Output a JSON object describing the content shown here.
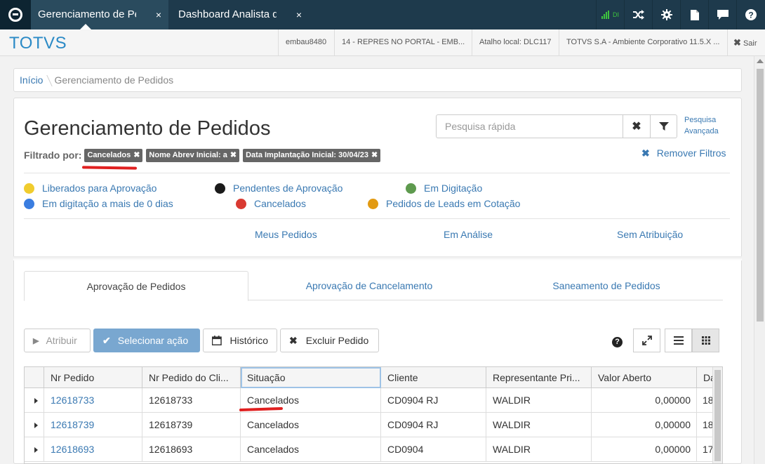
{
  "topbar": {
    "tabs": [
      {
        "label": "Gerenciamento de Pedidos",
        "close": "×"
      },
      {
        "label": "Dashboard Analista de",
        "close": "×"
      }
    ],
    "signal_label": "DI"
  },
  "header": {
    "brand": "TOTVS",
    "cells": [
      "embau8480",
      "14 - REPRES NO PORTAL - EMB...",
      "Atalho local: DLC117",
      "TOTVS S.A - Ambiente Corporativo 11.5.X ..."
    ],
    "logout_label": "Sair"
  },
  "breadcrumb": {
    "home": "Início",
    "current": "Gerenciamento de Pedidos"
  },
  "page": {
    "title": "Gerenciamento de Pedidos",
    "filter_label": "Filtrado por:",
    "filters": [
      "Cancelados",
      "Nome Abrev Inicial: a",
      "Data Implantação Inicial: 30/04/23"
    ],
    "search_placeholder": "Pesquisa rápida",
    "advanced_search": [
      "Pesquisa",
      "Avançada"
    ],
    "remove_filters": "Remover Filtros"
  },
  "legend": [
    {
      "label": "Liberados para Aprovação",
      "color": "#f0cc2e"
    },
    {
      "label": "Pendentes de Aprovação",
      "color": "#1a1a1a"
    },
    {
      "label": "Em Digitação",
      "color": "#5e9a4e"
    },
    {
      "label": "Em digitação a mais de 0 dias",
      "color": "#3a7de0"
    },
    {
      "label": "Cancelados",
      "color": "#d93a32"
    },
    {
      "label": "Pedidos de Leads em Cotação",
      "color": "#e29a12"
    }
  ],
  "quick_links": [
    "Meus Pedidos",
    "Em Análise",
    "Sem Atribuição"
  ],
  "tabs": [
    "Aprovação de Pedidos",
    "Aprovação de Cancelamento",
    "Saneamento de Pedidos"
  ],
  "toolbar": {
    "assign": "Atribuir",
    "select_action": "Selecionar ação",
    "history": "Histórico",
    "delete_order": "Excluir Pedido",
    "help": "?"
  },
  "grid": {
    "columns": [
      "Nr Pedido",
      "Nr Pedido do Cli...",
      "Situação",
      "Cliente",
      "Representante Pri...",
      "Valor Aberto",
      "Da"
    ],
    "rows": [
      [
        "12618733",
        "12618733",
        "Cancelados",
        "CD0904 RJ",
        "WALDIR",
        "0,00000",
        "18"
      ],
      [
        "12618739",
        "12618739",
        "Cancelados",
        "CD0904 RJ",
        "WALDIR",
        "0,00000",
        "18"
      ],
      [
        "12618693",
        "12618693",
        "Cancelados",
        "CD0904",
        "WALDIR",
        "0,00000",
        "17"
      ]
    ]
  },
  "colors": {
    "topbar": "#1e3a4c",
    "brand": "#2b8ac6",
    "link": "#3a79b2",
    "primary_button": "#79a7d0",
    "annotation_red": "#e02020"
  }
}
